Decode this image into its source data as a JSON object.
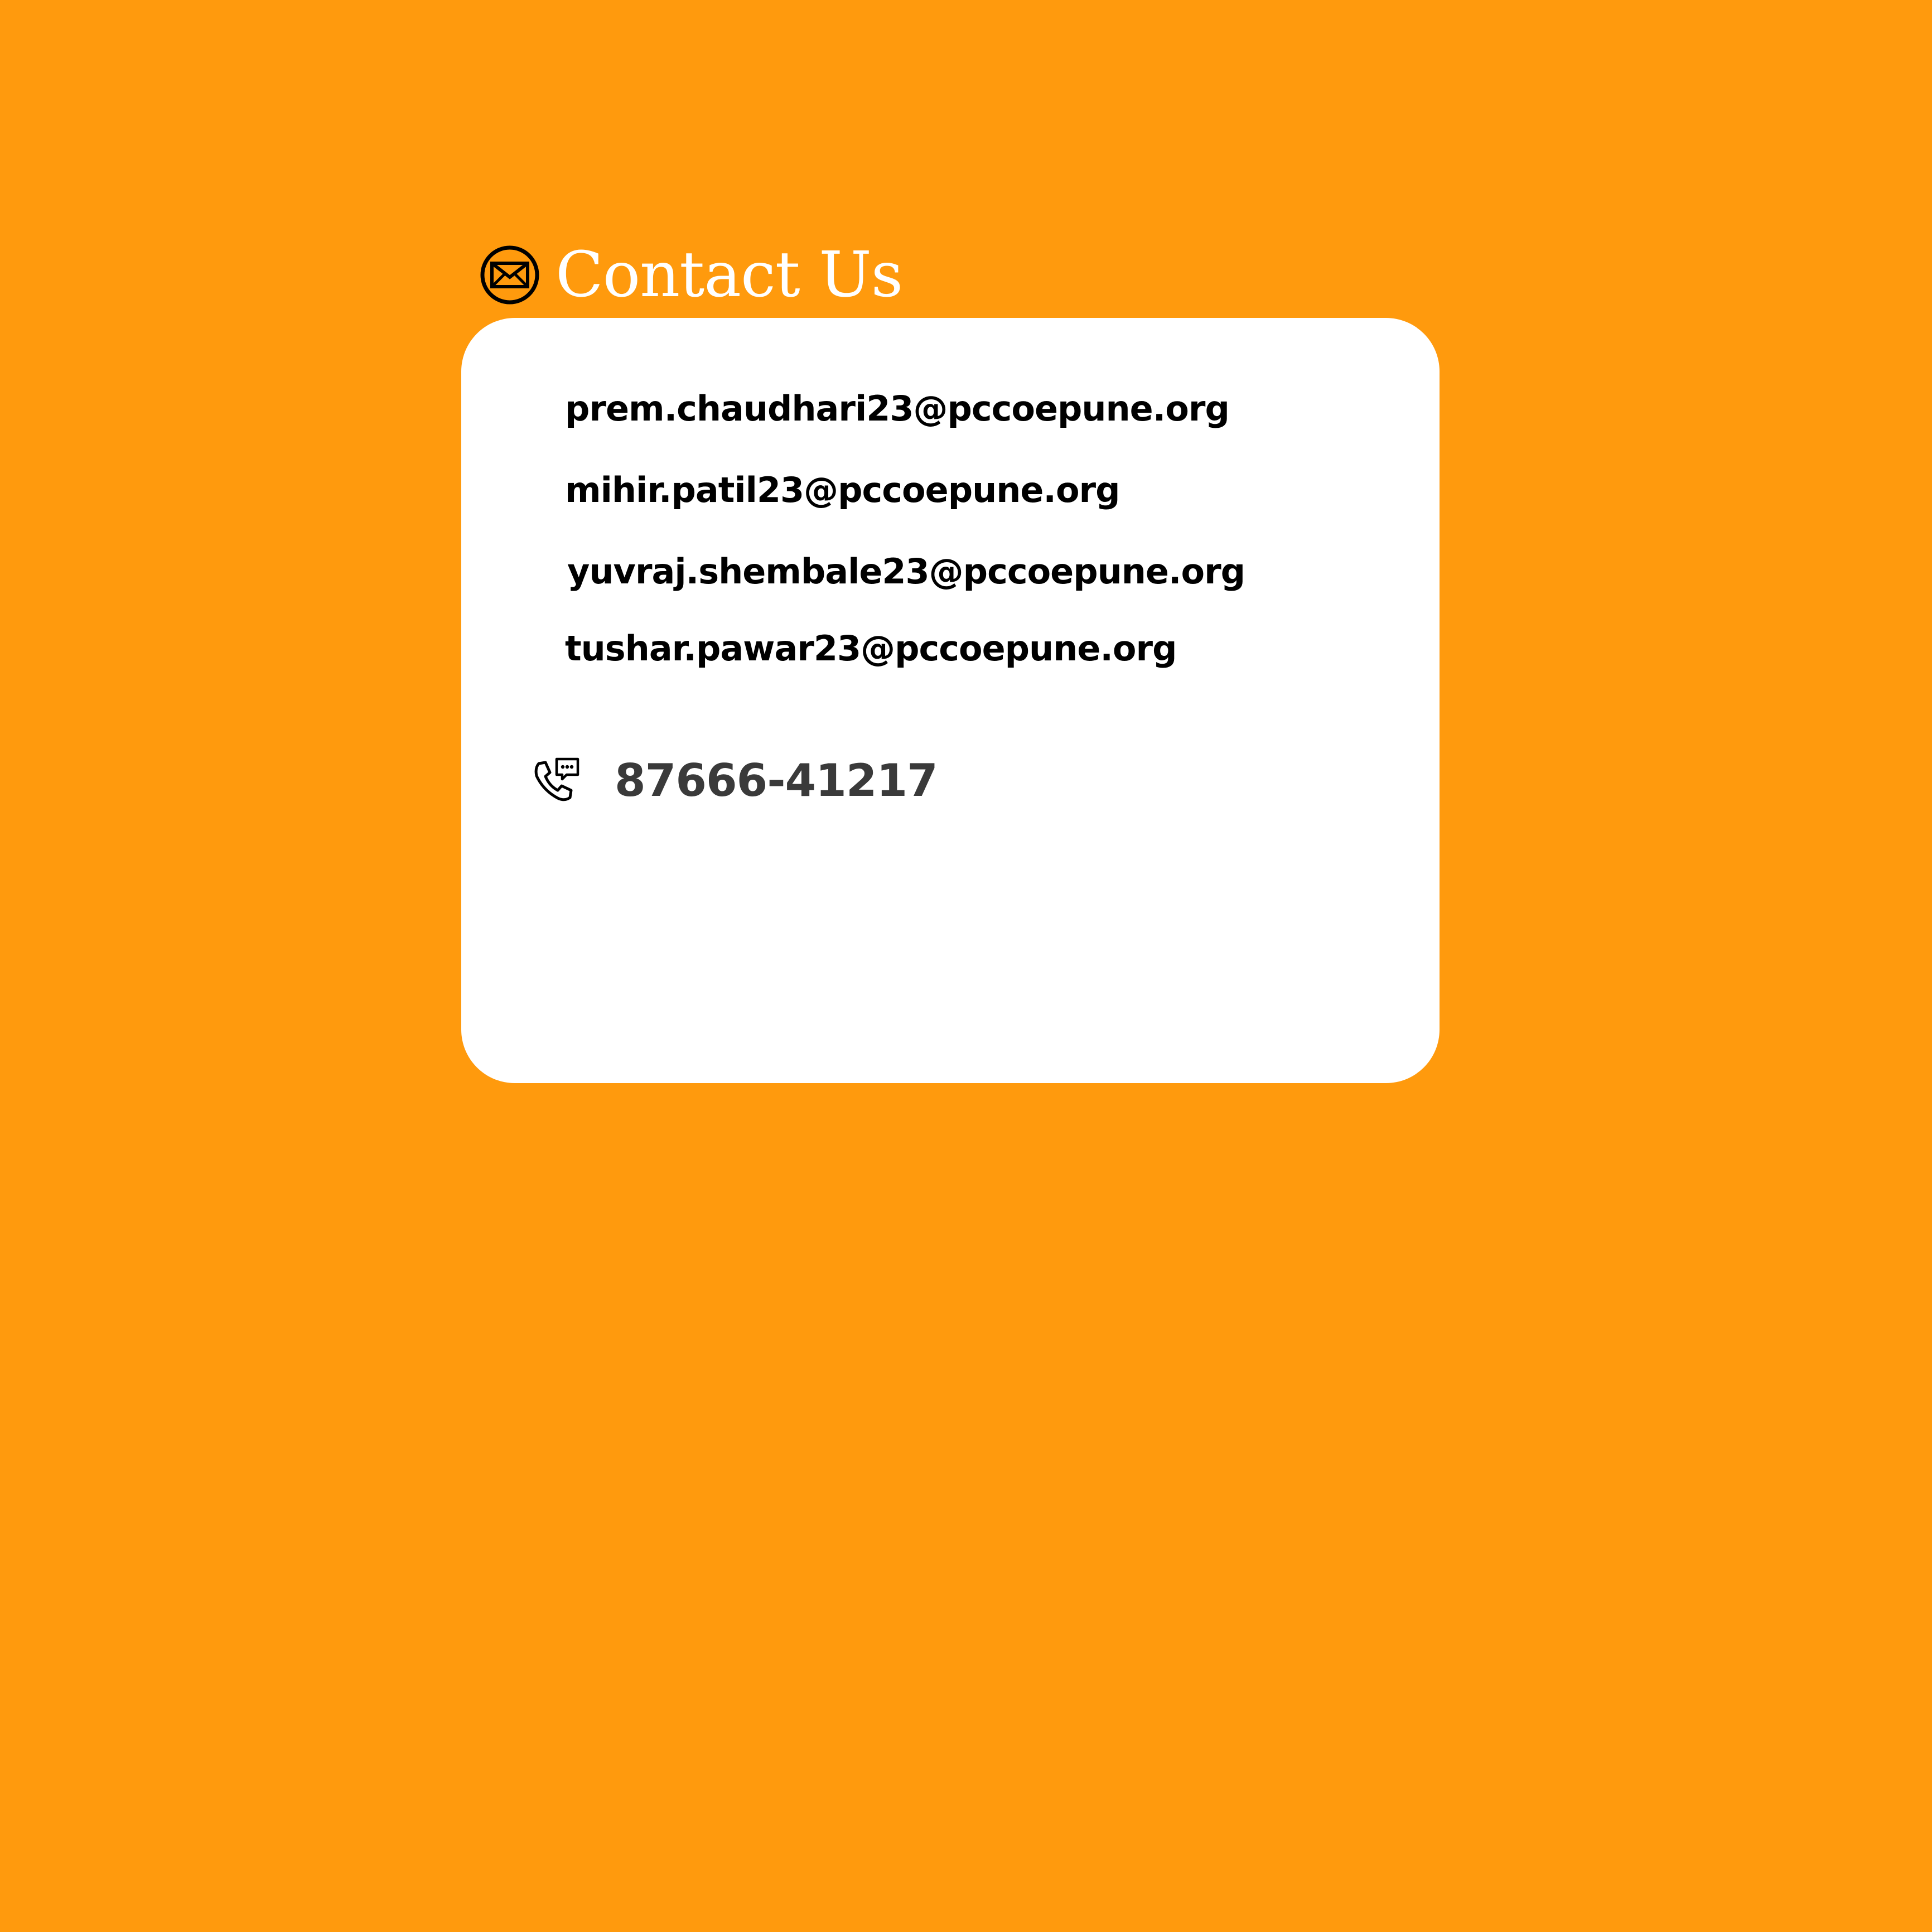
{
  "header": {
    "title": "Contact Us",
    "icon": "envelope-icon"
  },
  "contacts": {
    "emails": [
      "prem.chaudhari23@pccoepune.org",
      "mihir.patil23@pccoepune.org",
      "yuvraj.shembale23@pccoepune.org",
      "tushar.pawar23@pccoepune.org"
    ],
    "phone": "87666-41217",
    "phone_icon": "phone-chat-icon"
  },
  "colors": {
    "background": "#FF9A0D",
    "card": "#ffffff",
    "title": "#ffffff",
    "email_text": "#000000",
    "phone_text": "#3a3a3a"
  }
}
